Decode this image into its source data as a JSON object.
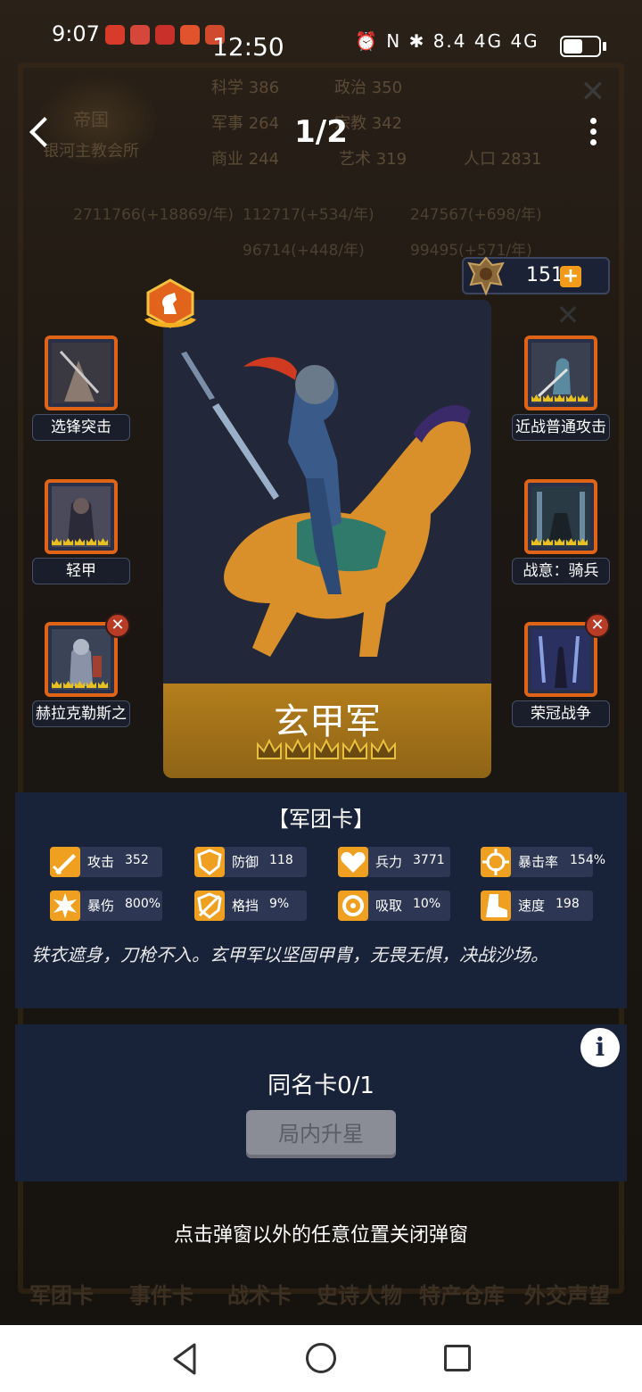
{
  "status_bar": {
    "time_left": "9:07",
    "time_center": "12:50",
    "right_icons_text": "⏰ N ✱ 8.4 4G 4G",
    "battery_percent": 55
  },
  "header": {
    "counter": "1/2"
  },
  "background": {
    "emblem_label": "帝国",
    "emblem_sub": "银河主教会所",
    "stats": [
      "科学 386",
      "政治 350",
      "军事 264",
      "宗教 342",
      "商业 244",
      "艺术 319",
      "人口 2831"
    ],
    "resources": [
      "2711766(+18869/年)",
      "112717(+534/年)",
      "247567(+698/年)",
      "96714(+448/年)",
      "99495(+571/年)"
    ],
    "tabs": [
      "军团卡",
      "事件卡",
      "战术卡",
      "史诗人物",
      "特产仓库",
      "外交声望"
    ]
  },
  "crest": {
    "count": "151",
    "plus": "+"
  },
  "card": {
    "name": "玄甲军",
    "stars": 5
  },
  "skills_left": [
    {
      "label": "选锋突击",
      "stars": 0,
      "removable": false
    },
    {
      "label": "轻甲",
      "stars": 5,
      "removable": false
    },
    {
      "label": "赫拉克勒斯之",
      "stars": 5,
      "removable": true
    }
  ],
  "skills_right": [
    {
      "label": "近战普通攻击",
      "stars": 5,
      "removable": false
    },
    {
      "label": "战意：骑兵",
      "stars": 5,
      "removable": false
    },
    {
      "label": "荣冠战争",
      "stars": 0,
      "removable": true
    }
  ],
  "info": {
    "title": "【军团卡】",
    "stats": [
      {
        "label": "攻击",
        "value": "352",
        "icon": "sword-icon"
      },
      {
        "label": "防御",
        "value": "118",
        "icon": "shield-icon"
      },
      {
        "label": "兵力",
        "value": "3771",
        "icon": "heart-icon"
      },
      {
        "label": "暴击率",
        "value": "154%",
        "icon": "crit-icon"
      },
      {
        "label": "暴伤",
        "value": "800%",
        "icon": "burst-icon"
      },
      {
        "label": "格挡",
        "value": "9%",
        "icon": "block-icon"
      },
      {
        "label": "吸取",
        "value": "10%",
        "icon": "drain-icon"
      },
      {
        "label": "速度",
        "value": "198",
        "icon": "boot-icon"
      }
    ],
    "description": "铁衣遮身，刀枪不入。玄甲军以坚固甲胄，无畏无惧，决战沙场。"
  },
  "upgrade": {
    "same_card_count": "同名卡0/1",
    "button_label": "局内升星",
    "info_icon": "i"
  },
  "dismiss_hint": "点击弹窗以外的任意位置关闭弹窗",
  "colors": {
    "panel": "#182239",
    "frame_orange": "#e06418",
    "card_gold": "#b47e1c",
    "plus_orange": "#f29a1a"
  }
}
